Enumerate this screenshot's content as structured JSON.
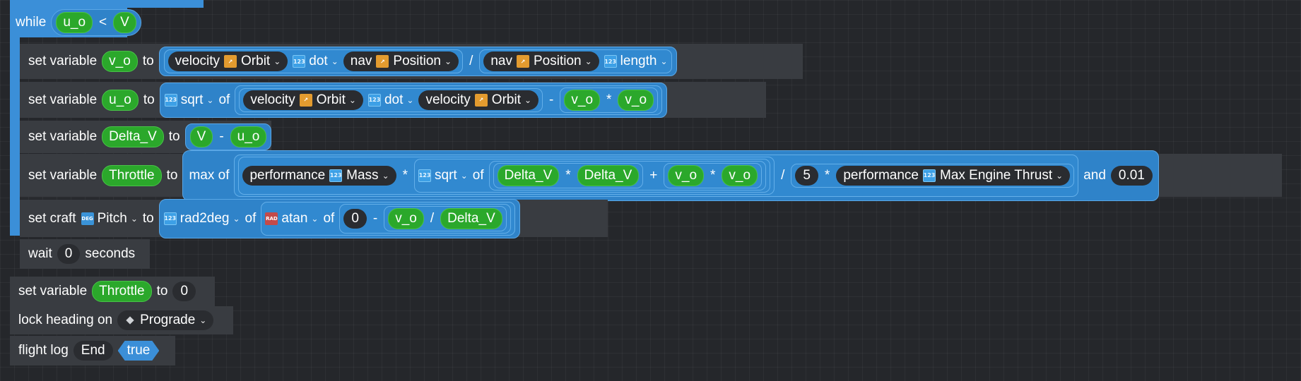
{
  "loop": {
    "keyword": "while",
    "cond_left": "u_o",
    "cond_op": "<",
    "cond_right": "V"
  },
  "kw": {
    "set_variable": "set variable",
    "to": "to",
    "of": "of",
    "max_of": "max of",
    "and": "and",
    "set_craft": "set craft",
    "wait": "wait",
    "seconds": "seconds",
    "lock_heading_on": "lock heading on",
    "flight_log": "flight log"
  },
  "ops": {
    "div": "/",
    "minus": "-",
    "mul": "*",
    "plus": "+"
  },
  "row1": {
    "var": "v_o",
    "velocity": "velocity",
    "orbit": "Orbit",
    "dot": "dot",
    "nav": "nav",
    "position": "Position",
    "nav2": "nav",
    "position2": "Position",
    "length": "length"
  },
  "row2": {
    "var": "u_o",
    "sqrt": "sqrt",
    "velocity": "velocity",
    "orbit": "Orbit",
    "dot": "dot",
    "velocity2": "velocity",
    "orbit2": "Orbit",
    "a": "v_o",
    "b": "v_o"
  },
  "row3": {
    "var": "Delta_V",
    "a": "V",
    "b": "u_o"
  },
  "row4": {
    "var": "Throttle",
    "performance": "performance",
    "mass": "Mass",
    "sqrt": "sqrt",
    "a": "Delta_V",
    "b": "Delta_V",
    "c": "v_o",
    "d": "v_o",
    "five": "5",
    "performance2": "performance",
    "thrust": "Max Engine Thrust",
    "min": "0.01"
  },
  "row5": {
    "pitch": "Pitch",
    "rad2deg": "rad2deg",
    "atan": "atan",
    "zero": "0",
    "a": "v_o",
    "b": "Delta_V"
  },
  "row6": {
    "value": "0"
  },
  "after1": {
    "var": "Throttle",
    "value": "0"
  },
  "after2": {
    "value": "Prograde"
  },
  "after3": {
    "text": "End",
    "flag": "true"
  },
  "icons": {
    "position_type": "position-type-icon",
    "number_type": "number-type-icon",
    "deg_label": "DEG",
    "rad_label": "RAD",
    "num_label": "123"
  }
}
